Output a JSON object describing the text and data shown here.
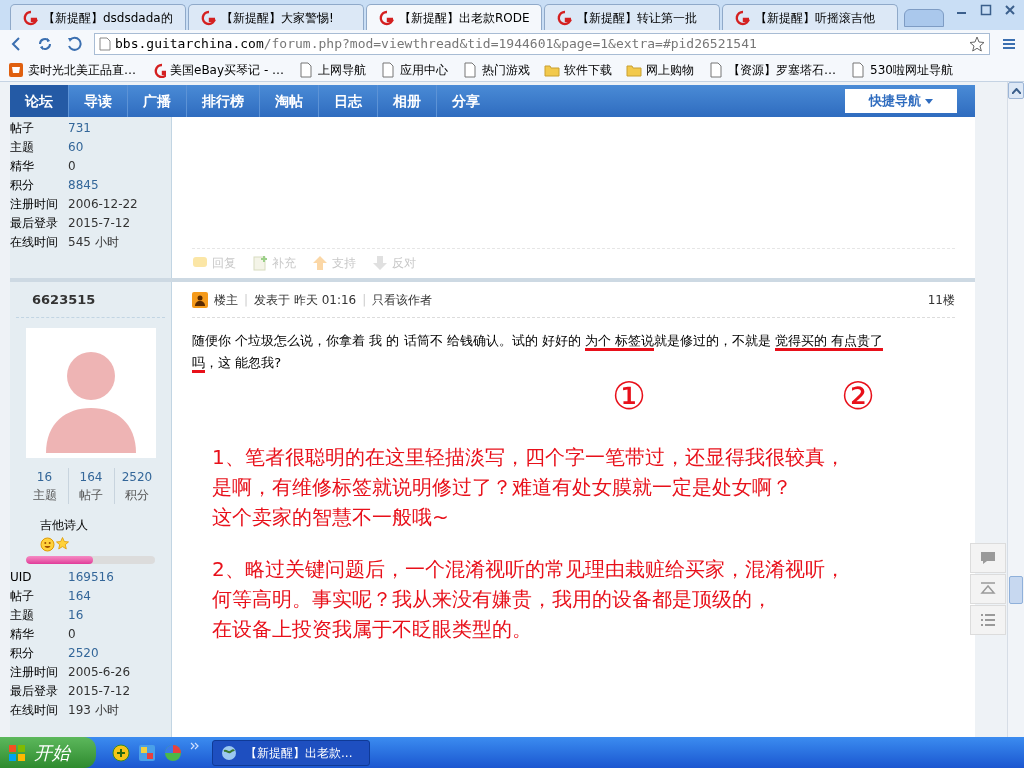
{
  "browser": {
    "tabs": [
      {
        "title": "【新提醒】dsdsdada的",
        "selected": false
      },
      {
        "title": "【新提醒】大家警惕!",
        "selected": false
      },
      {
        "title": "【新提醒】出老款RODE",
        "selected": true
      },
      {
        "title": "【新提醒】转让第一批",
        "selected": false
      },
      {
        "title": "【新提醒】听摇滚吉他",
        "selected": false
      }
    ],
    "url_host": "bbs.guitarchina.com",
    "url_path": "/forum.php?mod=viewthread&tid=1944601&page=1&extra=#pid26521541",
    "bookmarks": [
      {
        "label": "卖时光北美正品直…",
        "kind": "shop"
      },
      {
        "label": "美国eBay买琴记 - …",
        "kind": "logo"
      },
      {
        "label": "上网导航",
        "kind": "page"
      },
      {
        "label": "应用中心",
        "kind": "page"
      },
      {
        "label": "热门游戏",
        "kind": "page"
      },
      {
        "label": "软件下载",
        "kind": "folder"
      },
      {
        "label": "网上购物",
        "kind": "folder"
      },
      {
        "label": "【资源】罗塞塔石…",
        "kind": "page"
      },
      {
        "label": "530啦网址导航",
        "kind": "page"
      }
    ]
  },
  "nav": {
    "items": [
      {
        "label": "论坛",
        "selected": true
      },
      {
        "label": "导读",
        "selected": false
      },
      {
        "label": "广播",
        "selected": false
      },
      {
        "label": "排行榜",
        "selected": false
      },
      {
        "label": "淘帖",
        "selected": false
      },
      {
        "label": "日志",
        "selected": false
      },
      {
        "label": "相册",
        "selected": false
      },
      {
        "label": "分享",
        "selected": false
      }
    ],
    "quick_nav": "快捷导航"
  },
  "prev_post": {
    "profile": [
      {
        "label": "帖子",
        "value": "731",
        "kind": "link"
      },
      {
        "label": "主题",
        "value": "60",
        "kind": "link"
      },
      {
        "label": "精华",
        "value": "0",
        "kind": "plain"
      },
      {
        "label": "积分",
        "value": "8845",
        "kind": "link"
      },
      {
        "label": "注册时间",
        "value": "2006-12-22",
        "kind": "plain"
      },
      {
        "label": "最后登录",
        "value": "2015-7-12",
        "kind": "plain"
      },
      {
        "label": "在线时间",
        "value": "545 小时",
        "kind": "plain"
      }
    ],
    "actions": [
      {
        "label": "回复",
        "kind": "reply"
      },
      {
        "label": "补充",
        "kind": "add"
      },
      {
        "label": "支持",
        "kind": "up"
      },
      {
        "label": "反对",
        "kind": "down"
      }
    ]
  },
  "post": {
    "author": "6623515",
    "stats": [
      {
        "value": "16",
        "label": "主题"
      },
      {
        "value": "164",
        "label": "帖子"
      },
      {
        "value": "2520",
        "label": "积分"
      }
    ],
    "rank": "吉他诗人",
    "level": 0.52,
    "profile": [
      {
        "label": "UID",
        "value": "169516",
        "kind": "link"
      },
      {
        "label": "帖子",
        "value": "164",
        "kind": "link"
      },
      {
        "label": "主题",
        "value": "16",
        "kind": "link"
      },
      {
        "label": "精华",
        "value": "0",
        "kind": "plain"
      },
      {
        "label": "积分",
        "value": "2520",
        "kind": "link"
      },
      {
        "label": "注册时间",
        "value": "2005-6-26",
        "kind": "plain"
      },
      {
        "label": "最后登录",
        "value": "2015-7-12",
        "kind": "plain"
      },
      {
        "label": "在线时间",
        "value": "193 小时",
        "kind": "plain"
      }
    ],
    "header": {
      "role": "楼主",
      "separator": "|",
      "posted": "发表于 昨天 01:16",
      "author_only": "只看该作者",
      "floor": "11楼"
    },
    "body": [
      {
        "text": "随便你 个垃圾怎么说，你拿着 我 的 话筒不 给钱确认。试的 好好的  ",
        "underlined": false
      },
      {
        "text": "为个 标签说",
        "underlined": true
      },
      {
        "text": "就是修过的，不就是 ",
        "underlined": false
      },
      {
        "text": "觉得买的 有点贵了吗",
        "underlined": true
      },
      {
        "text": "，这 能忽我?",
        "underlined": false
      }
    ]
  },
  "annotations": {
    "marks": [
      "①",
      "②"
    ],
    "notes": [
      [
        "1、笔者很聪明的在这里轻描淡写，四个字一笔带过，还显得我很较真，",
        "是啊，有维修标签就说明修过了？难道有处女膜就一定是处女啊？",
        "这个卖家的智慧不一般哦~"
      ],
      [
        "2、略过关键问题后，一个混淆视听的常见理由栽赃给买家，混淆视听，",
        "何等高明。事实呢？我从来没有嫌贵，我用的设备都是顶级的，",
        "在设备上投资我属于不眨眼类型的。"
      ]
    ]
  },
  "taskbar": {
    "start": "开始",
    "task": "【新提醒】出老款..."
  }
}
